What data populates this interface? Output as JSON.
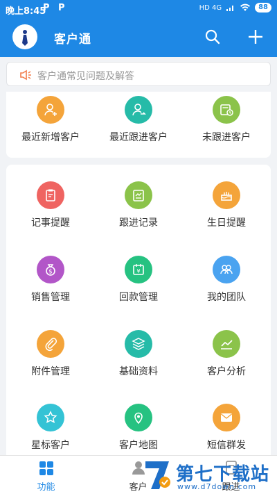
{
  "status_bar": {
    "time": "晚上8:45",
    "battery": "88",
    "network": "HD 4G"
  },
  "app_bar": {
    "title": "客户通"
  },
  "notice": {
    "text": "客户通常见问题及解答"
  },
  "quick_items": [
    {
      "label": "最近新增客户",
      "color": "#f4a43a",
      "icon": "add-user-icon"
    },
    {
      "label": "最近跟进客户",
      "color": "#26bba8",
      "icon": "follow-user-icon"
    },
    {
      "label": "未跟进客户",
      "color": "#8bc34a",
      "icon": "calendar-clock-icon"
    }
  ],
  "grid_items": [
    {
      "label": "记事提醒",
      "color": "#ef6461",
      "icon": "clipboard-icon"
    },
    {
      "label": "跟进记录",
      "color": "#8bc34a",
      "icon": "record-icon"
    },
    {
      "label": "生日提醒",
      "color": "#f4a43a",
      "icon": "cake-icon"
    },
    {
      "label": "销售管理",
      "color": "#b256c8",
      "icon": "money-bag-icon"
    },
    {
      "label": "回款管理",
      "color": "#26c281",
      "icon": "yuan-calendar-icon"
    },
    {
      "label": "我的团队",
      "color": "#4aa3f0",
      "icon": "team-icon"
    },
    {
      "label": "附件管理",
      "color": "#f4a43a",
      "icon": "paperclip-icon"
    },
    {
      "label": "基础资料",
      "color": "#26bba8",
      "icon": "layers-icon"
    },
    {
      "label": "客户分析",
      "color": "#8bc34a",
      "icon": "trend-chart-icon"
    },
    {
      "label": "星标客户",
      "color": "#34c3d5",
      "icon": "star-icon"
    },
    {
      "label": "客户地图",
      "color": "#26c281",
      "icon": "map-pin-icon"
    },
    {
      "label": "短信群发",
      "color": "#f4a43a",
      "icon": "mail-icon"
    }
  ],
  "bottom_nav": [
    {
      "label": "功能",
      "active": true
    },
    {
      "label": "客户",
      "active": false
    },
    {
      "label": "跟进",
      "active": false
    }
  ],
  "watermark": {
    "brand": "第七下载站",
    "url": "www.d7down.com"
  },
  "colors": {
    "primary": "#1e88e5",
    "active_tab": "#1e88e5",
    "inactive_tab": "#333333"
  }
}
